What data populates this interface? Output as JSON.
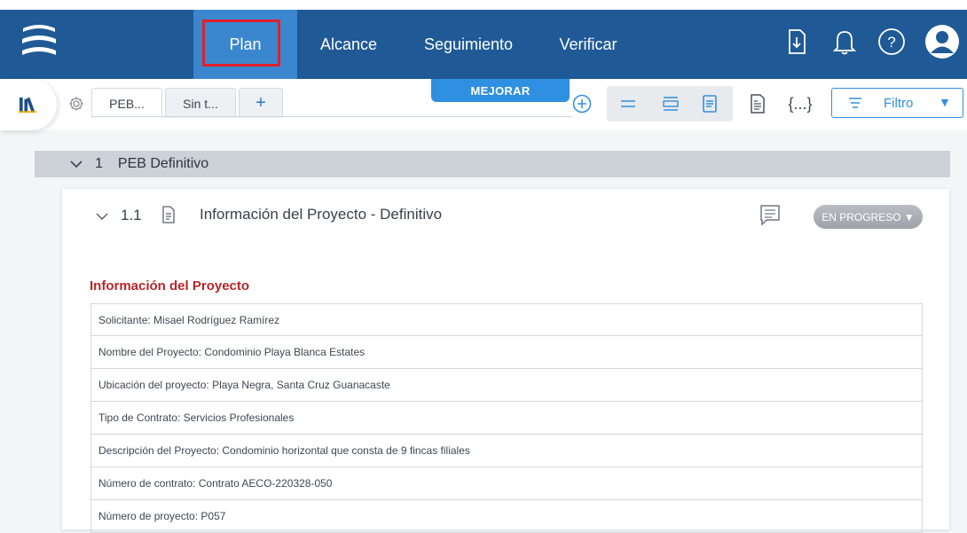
{
  "nav": {
    "tabs": [
      "Plan",
      "Alcance",
      "Seguimiento",
      "Verificar"
    ],
    "active_tab": "Plan"
  },
  "toolbar": {
    "doc_tabs": [
      "PEB...",
      "Sin t..."
    ],
    "add_tab_label": "+",
    "mejorar_label": "MEJORAR",
    "code_label": "{...}",
    "filter_label": "Filtro",
    "filter_arrow": "▼"
  },
  "section": {
    "number": "1",
    "title": "PEB Definitivo"
  },
  "card": {
    "number": "1.1",
    "title": "Información del Proyecto - Definitivo",
    "status": "EN PROGRESO ▼",
    "info_heading": "Información del Proyecto",
    "rows": [
      "Solicitante: Misael Rodríguez Ramírez",
      "Nombre del Proyecto: Condominio Playa Blanca Estates",
      "Ubicación del proyecto: Playa Negra, Santa Cruz Guanacaste",
      "Tipo de Contrato: Servicios Profesionales",
      "Descripción del Proyecto: Condominio horizontal que consta de 9 fincas filiales",
      "Número de contrato: Contrato AECO-220328-050",
      "Número de proyecto: P057"
    ]
  },
  "colors": {
    "topbar": "#1f5a96",
    "active_tab": "#3a86cf",
    "highlight_box": "#e0202a",
    "accent": "#2f8fe0",
    "heading_red": "#b5262a"
  },
  "icons": [
    "menu-icon",
    "export-icon",
    "bell-icon",
    "help-icon",
    "user-avatar-icon",
    "library-icon",
    "gear-icon",
    "add-circle-icon",
    "compact-view-icon",
    "list-view-icon",
    "detail-view-icon",
    "document-view-icon",
    "code-icon",
    "filter-icon",
    "chevron-down-icon",
    "document-icon",
    "comment-icon"
  ]
}
